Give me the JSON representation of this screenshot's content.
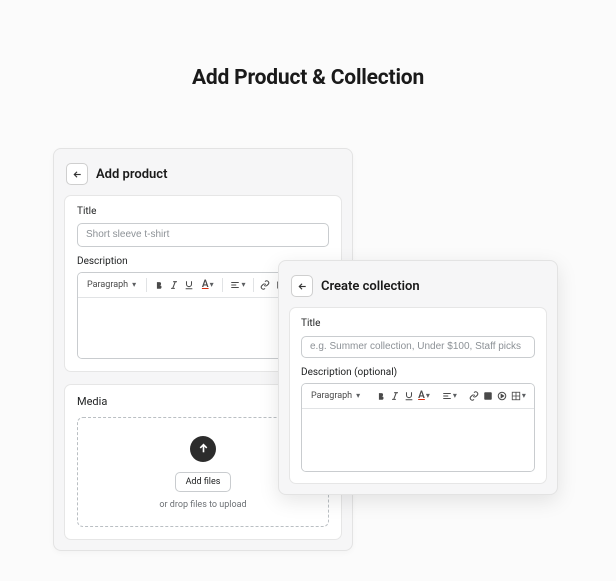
{
  "page": {
    "title": "Add Product & Collection"
  },
  "product": {
    "heading": "Add product",
    "titleLabel": "Title",
    "titlePlaceholder": "Short sleeve t-shirt",
    "descLabel": "Description",
    "paragraph": "Paragraph",
    "mediaLabel": "Media",
    "addFiles": "Add files",
    "dropHint": "or drop files to upload"
  },
  "collection": {
    "heading": "Create collection",
    "titleLabel": "Title",
    "titlePlaceholder": "e.g. Summer collection, Under $100, Staff picks",
    "descLabel": "Description (optional)",
    "paragraph": "Paragraph"
  }
}
